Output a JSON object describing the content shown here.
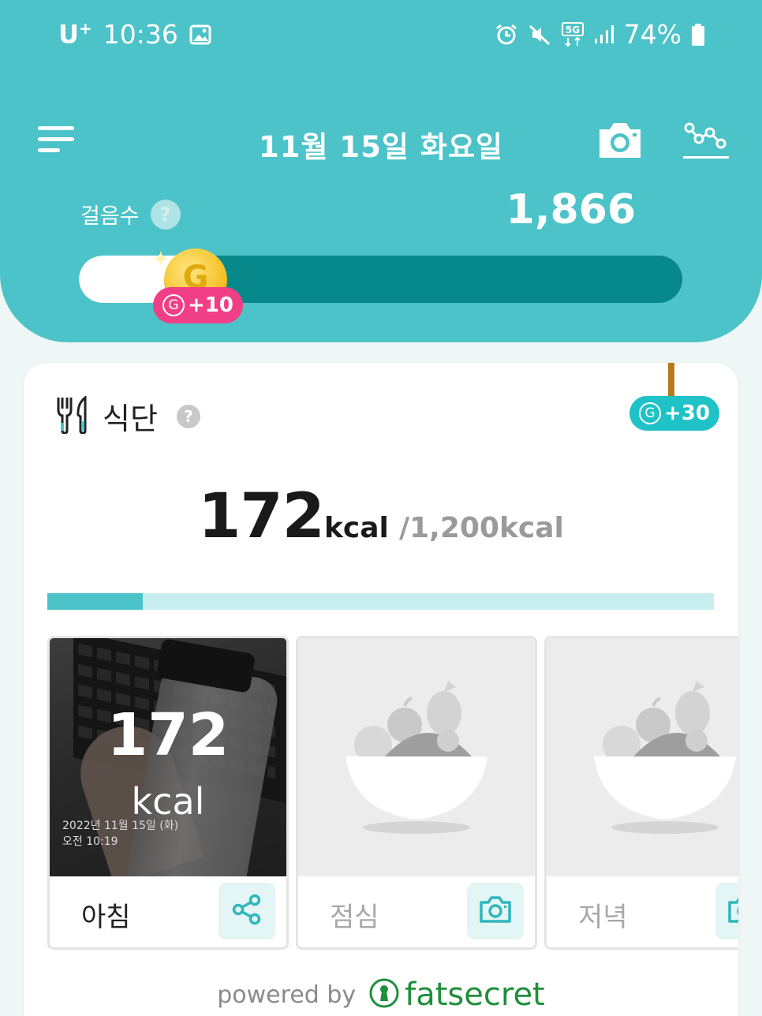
{
  "status_bar": {
    "carrier": "U",
    "carrier_sup": "+",
    "time": "10:36",
    "battery": "74%",
    "network": "5G"
  },
  "header": {
    "date": "11월 15일 화요일",
    "steps_label": "걸음수",
    "help": "?",
    "steps_value": "1,866",
    "steps_progress": 0.18,
    "reward": "+10",
    "reward_g": "G"
  },
  "diet": {
    "title": "식단",
    "help": "?",
    "reward": "+30",
    "reward_g": "G",
    "consumed": "172",
    "consumed_unit": "kcal",
    "target": "/1,200kcal",
    "progress": 0.143,
    "meals": [
      {
        "label": "아침",
        "kcal": "172",
        "kcal_unit": "kcal",
        "stamp_date": "2022년 11월 15일 (화)",
        "stamp_time": "오전 10:19",
        "action": "share-icon"
      },
      {
        "label": "점심",
        "action": "camera-icon"
      },
      {
        "label": "저녁",
        "action": "camera-icon"
      }
    ]
  },
  "footer": {
    "powered_by": "powered by",
    "brand": "fatsecret"
  },
  "colors": {
    "header_teal": "#4cc3c8",
    "progress_dark": "#07898b",
    "reward_pink": "#f03f86",
    "reward_teal": "#1fc2c6",
    "brand_green": "#1f8f3a"
  }
}
